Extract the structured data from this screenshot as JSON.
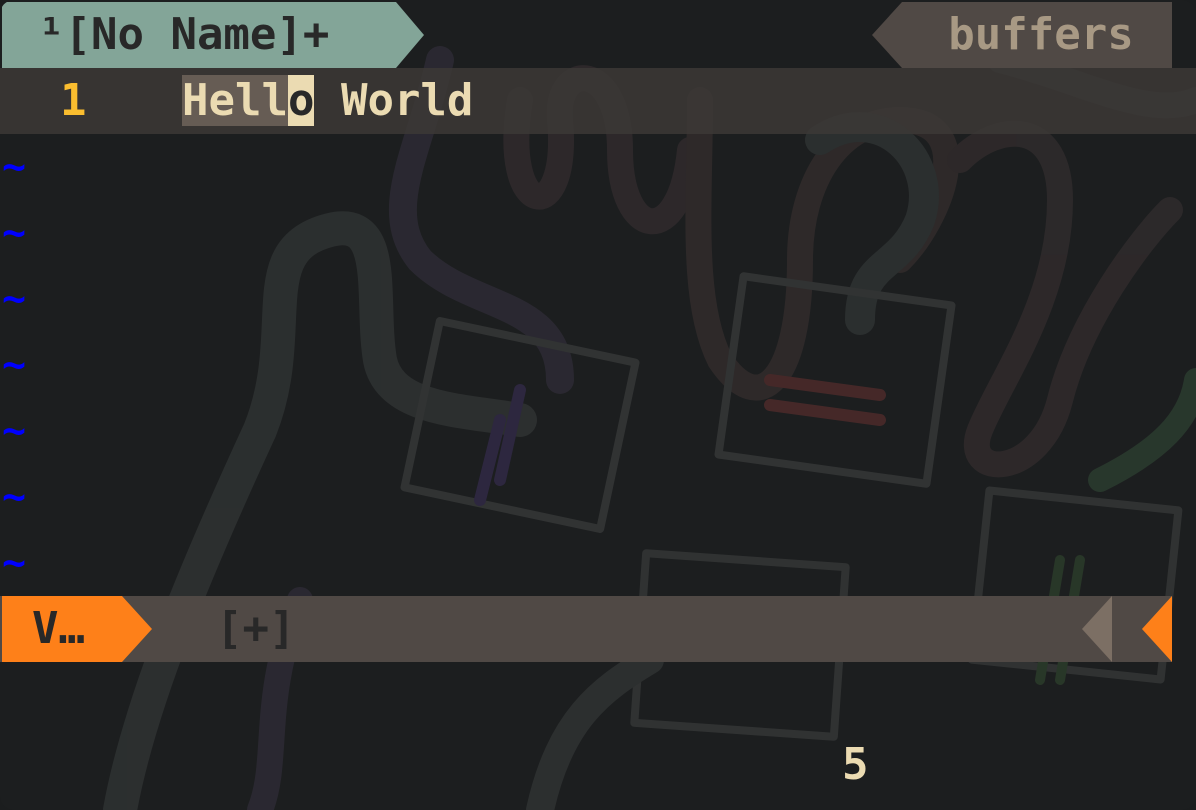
{
  "tabline": {
    "active_tab_label": "¹[No Name]+",
    "right_label": "buffers"
  },
  "editor": {
    "line_number": "1",
    "line_text_selected": "Hell",
    "line_text_cursor": "o",
    "line_text_rest": " World",
    "tilde": "~"
  },
  "statusline": {
    "mode": "V…",
    "modified_flag": "[+]"
  },
  "cmdline": {
    "selection_count": "5"
  },
  "colors": {
    "tab_active_bg": "#83a598",
    "mode_bg": "#fe8019",
    "line_number": "#fabd2f",
    "tilde": "#0000ff"
  }
}
